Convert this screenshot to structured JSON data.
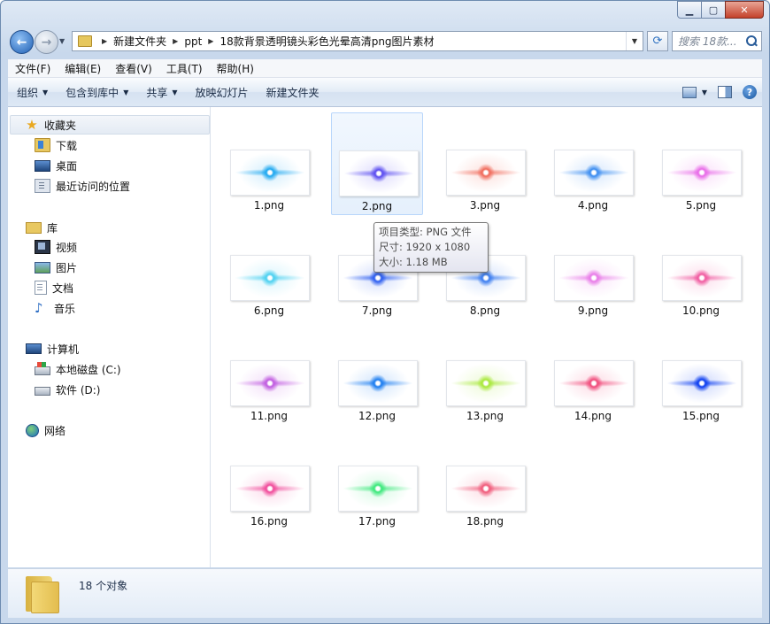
{
  "window": {
    "minimize_glyph": "▁",
    "maximize_glyph": "▢",
    "close_glyph": "✕"
  },
  "address_bar": {
    "breadcrumbs": [
      "新建文件夹",
      "ppt",
      "18款背景透明镜头彩色光晕高清png图片素材"
    ]
  },
  "search": {
    "placeholder": "搜索 18款..."
  },
  "menu": [
    "文件(F)",
    "编辑(E)",
    "查看(V)",
    "工具(T)",
    "帮助(H)"
  ],
  "commands": {
    "organize": "组织",
    "include_in_library": "包含到库中",
    "share": "共享",
    "slideshow": "放映幻灯片",
    "new_folder": "新建文件夹"
  },
  "nav": {
    "favorites": "收藏夹",
    "downloads": "下载",
    "desktop": "桌面",
    "recent": "最近访问的位置",
    "libraries": "库",
    "videos": "视频",
    "pictures": "图片",
    "documents": "文档",
    "music": "音乐",
    "computer": "计算机",
    "drive_c": "本地磁盘 (C:)",
    "drive_d": "软件 (D:)",
    "network": "网络"
  },
  "files": [
    {
      "name": "1.png",
      "color": "#1ea8f0"
    },
    {
      "name": "2.png",
      "color": "#5a4cf0"
    },
    {
      "name": "3.png",
      "color": "#f06a5a"
    },
    {
      "name": "4.png",
      "color": "#3a8cf0"
    },
    {
      "name": "5.png",
      "color": "#e86ae8"
    },
    {
      "name": "6.png",
      "color": "#4ad0f0"
    },
    {
      "name": "7.png",
      "color": "#2a5cf0"
    },
    {
      "name": "8.png",
      "color": "#3a7cf0"
    },
    {
      "name": "9.png",
      "color": "#e87ae8"
    },
    {
      "name": "10.png",
      "color": "#f05aa0"
    },
    {
      "name": "11.png",
      "color": "#c05ae0"
    },
    {
      "name": "12.png",
      "color": "#1a7cf0"
    },
    {
      "name": "13.png",
      "color": "#a8e83a"
    },
    {
      "name": "14.png",
      "color": "#f04a7a"
    },
    {
      "name": "15.png",
      "color": "#0a3cf0"
    },
    {
      "name": "16.png",
      "color": "#f04a9a"
    },
    {
      "name": "17.png",
      "color": "#3ae87a"
    },
    {
      "name": "18.png",
      "color": "#f05a7a"
    }
  ],
  "tooltip": {
    "type": "项目类型: PNG 文件",
    "size": "尺寸: 1920 x 1080",
    "filesize": "大小: 1.18 MB"
  },
  "details": {
    "count": "18 个对象"
  }
}
